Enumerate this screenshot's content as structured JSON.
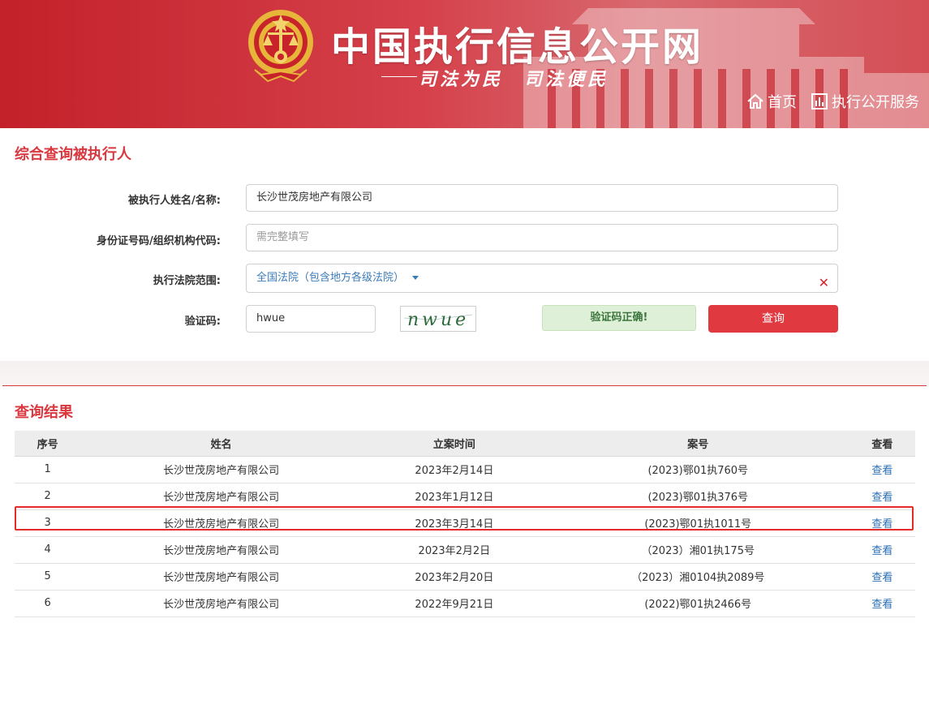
{
  "header": {
    "site_title": "中国执行信息公开网",
    "slogan": "司法为民　司法便民",
    "nav": {
      "home": "首页",
      "service": "执行公开服务"
    }
  },
  "form": {
    "title": "综合查询被执行人",
    "name_label": "被执行人姓名/名称:",
    "name_value": "长沙世茂房地产有限公司",
    "id_label": "身份证号码/组织机构代码:",
    "id_placeholder": "需完整填写",
    "court_label": "执行法院范围:",
    "court_value": "全国法院（包含地方各级法院）",
    "captcha_label": "验证码:",
    "captcha_value": "hwue",
    "captcha_image_text": "nwue",
    "captcha_ok": "验证码正确!",
    "query_button": "查询"
  },
  "results": {
    "title": "查询结果",
    "columns": [
      "序号",
      "姓名",
      "立案时间",
      "案号",
      "查看"
    ],
    "rows": [
      {
        "no": "1",
        "name": "长沙世茂房地产有限公司",
        "date": "2023年2月14日",
        "case": "(2023)鄂01执760号",
        "view": "查看"
      },
      {
        "no": "2",
        "name": "长沙世茂房地产有限公司",
        "date": "2023年1月12日",
        "case": "(2023)鄂01执376号",
        "view": "查看"
      },
      {
        "no": "3",
        "name": "长沙世茂房地产有限公司",
        "date": "2023年3月14日",
        "case": "(2023)鄂01执1011号",
        "view": "查看"
      },
      {
        "no": "4",
        "name": "长沙世茂房地产有限公司",
        "date": "2023年2月2日",
        "case": "（2023）湘01执175号",
        "view": "查看"
      },
      {
        "no": "5",
        "name": "长沙世茂房地产有限公司",
        "date": "2023年2月20日",
        "case": "（2023）湘0104执2089号",
        "view": "查看"
      },
      {
        "no": "6",
        "name": "长沙世茂房地产有限公司",
        "date": "2022年9月21日",
        "case": "(2022)鄂01执2466号",
        "view": "查看"
      }
    ]
  },
  "colors": {
    "brand_red": "#d9383f",
    "link_blue": "#2a6fb5",
    "highlight": "#e52a2a"
  }
}
